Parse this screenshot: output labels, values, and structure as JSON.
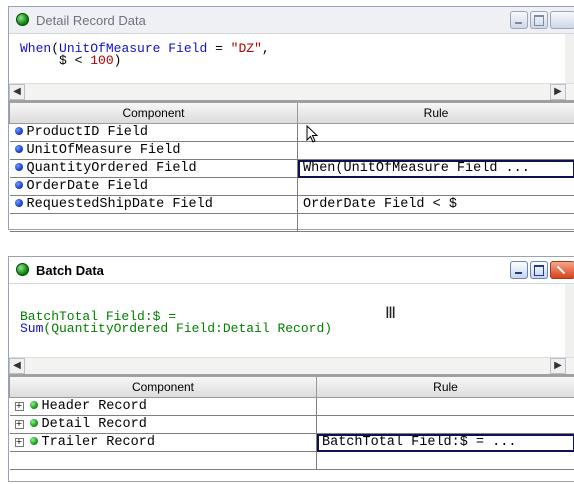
{
  "windows": [
    {
      "title": "Detail Record Data",
      "active": false,
      "code_lines": [
        [
          {
            "t": "When",
            "c": "kw"
          },
          {
            "t": "(",
            "c": "op"
          },
          {
            "t": "UnitOfMeasure Field",
            "c": "kw"
          },
          {
            "t": " = ",
            "c": "op"
          },
          {
            "t": "\"DZ\"",
            "c": "str"
          },
          {
            "t": ",",
            "c": "op"
          }
        ],
        [
          {
            "t": "     $ ",
            "c": "op"
          },
          {
            "t": "< ",
            "c": "op"
          },
          {
            "t": "100",
            "c": "num"
          },
          {
            "t": ")",
            "c": "op"
          }
        ]
      ],
      "columns": [
        "Component",
        "Rule"
      ],
      "rows": [
        {
          "icon": "blue-dot",
          "expand": false,
          "component": "ProductID Field",
          "rule": "",
          "selected": false
        },
        {
          "icon": "blue-dot",
          "expand": false,
          "component": "UnitOfMeasure Field",
          "rule": "",
          "selected": false
        },
        {
          "icon": "blue-dot",
          "expand": false,
          "component": "QuantityOrdered Field",
          "rule": "When(UnitOfMeasure Field ...",
          "selected": true
        },
        {
          "icon": "blue-dot",
          "expand": false,
          "component": "OrderDate Field",
          "rule": "",
          "selected": false
        },
        {
          "icon": "blue-dot",
          "expand": false,
          "component": "RequestedShipDate Field",
          "rule": "OrderDate Field < $",
          "selected": false
        },
        {
          "icon": "",
          "expand": false,
          "component": "",
          "rule": "",
          "selected": false
        }
      ]
    },
    {
      "title": "Batch Data",
      "active": true,
      "code_lines": [
        [
          {
            "t": "BatchTotal Field:$ =",
            "c": "fld"
          }
        ],
        [
          {
            "t": "Sum",
            "c": "kw"
          },
          {
            "t": "(QuantityOrdered Field:Detail Record)",
            "c": "fld"
          }
        ]
      ],
      "columns": [
        "Component",
        "Rule"
      ],
      "rows": [
        {
          "icon": "green-dot",
          "expand": true,
          "component": "Header Record",
          "rule": "",
          "selected": false
        },
        {
          "icon": "green-dot",
          "expand": true,
          "component": "Detail Record",
          "rule": "",
          "selected": false
        },
        {
          "icon": "green-dot",
          "expand": true,
          "component": "Trailer Record",
          "rule": "BatchTotal Field:$ = ...",
          "selected": true
        },
        {
          "icon": "",
          "expand": false,
          "component": "",
          "rule": "",
          "selected": false
        }
      ]
    }
  ],
  "colors": {
    "keyword": "#1010c8",
    "string": "#b00000",
    "field": "#008000",
    "selection": "#101050"
  }
}
